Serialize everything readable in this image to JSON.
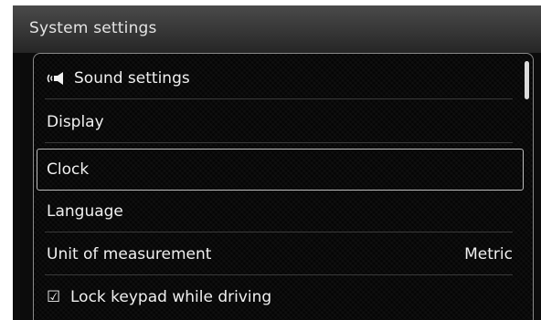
{
  "title": "System settings",
  "menu": {
    "items": [
      {
        "label": "Sound settings",
        "icon": "speaker-icon"
      },
      {
        "label": "Display"
      },
      {
        "label": "Clock"
      },
      {
        "label": "Language"
      },
      {
        "label": "Unit of measurement",
        "value": "Metric"
      },
      {
        "label": "Lock keypad while driving",
        "icon": "checkbox-checked-icon",
        "glyph": "☑"
      }
    ],
    "selected": "Clock"
  }
}
